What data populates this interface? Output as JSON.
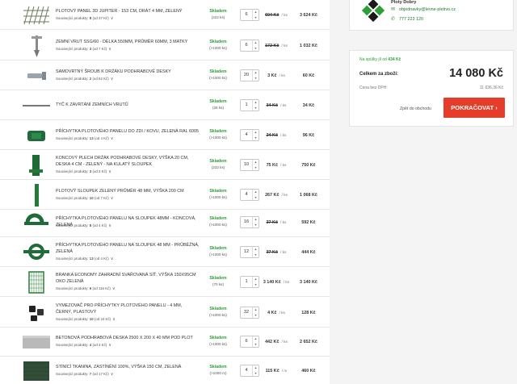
{
  "cart": {
    "items": [
      {
        "name": "Plotový panel 3D JUPITER - 153 cm, drát 4 mm, zelený",
        "related": {
          "prefix": "Související produkty:",
          "count": "8",
          "from": "(od 37 Kč)"
        },
        "stock": {
          "status": "Skladem",
          "qty": "(222 ks)"
        },
        "quantity": "6",
        "unit_price": "604 Kč",
        "unit": "/ ks",
        "strike": true,
        "total": "3 624 Kč"
      },
      {
        "name": "Zemní vrut SSG/60 - délka 550mm, průměr 60mm, 3 matky",
        "related": {
          "prefix": "Související produkty:",
          "count": "3",
          "from": "(od 7 Kč)"
        },
        "stock": {
          "status": "Skladem",
          "qty": "(>1000 ks)"
        },
        "quantity": "6",
        "unit_price": "172 Kč",
        "unit": "/ ks",
        "strike": true,
        "total": "1 032 Kč"
      },
      {
        "name": "Samovrtný šroub k držáku podhrabové desky",
        "related": {
          "prefix": "Související produkty:",
          "count": "2",
          "from": "(od 62 Kč)"
        },
        "stock": {
          "status": "Skladem",
          "qty": "(>1000 ks)"
        },
        "quantity": "20",
        "unit_price": "3 Kč",
        "unit": "/ ks",
        "strike": false,
        "total": "60 Kč"
      },
      {
        "name": "Tyč k zavrtání zemních vrutů",
        "related": null,
        "stock": {
          "status": "Skladem",
          "qty": "(28 ks)"
        },
        "quantity": "1",
        "unit_price": "34 Kč",
        "unit": "/ ks",
        "strike": true,
        "total": "34 Kč"
      },
      {
        "name": "Příchytka plotového panelu do zdi / kovu, zelená RAL 6005",
        "related": {
          "prefix": "Související produkty:",
          "count": "13",
          "from": "(od 4 Kč)"
        },
        "stock": {
          "status": "Skladem",
          "qty": "(>1000 ks)"
        },
        "quantity": "4",
        "unit_price": "24 Kč",
        "unit": "/ ks",
        "strike": true,
        "total": "96 Kč"
      },
      {
        "name": "Koncový plech držák podhrabové desky, výška 20 cm, deska 4 cm - zelený - na kulatý sloupek",
        "related": {
          "prefix": "Související produkty:",
          "count": "3",
          "from": "(od 3 Kč)"
        },
        "stock": {
          "status": "Skladem",
          "qty": "(232 ks)"
        },
        "quantity": "10",
        "unit_price": "75 Kč",
        "unit": "/ ks",
        "strike": false,
        "total": "750 Kč"
      },
      {
        "name": "Plotový sloupek zelený průměr 48 mm, výška 200 cm",
        "related": {
          "prefix": "Související produkty:",
          "count": "10",
          "from": "(od 7 Kč)"
        },
        "stock": {
          "status": "Skladem",
          "qty": "(>1000 ks)"
        },
        "quantity": "4",
        "unit_price": "267 Kč",
        "unit": "/ ks",
        "strike": false,
        "total": "1 068 Kč"
      },
      {
        "name": "Příchytka plotového panelu na sloupek 48mm - koncová, zelená",
        "related": {
          "prefix": "Související produkty:",
          "count": "8",
          "from": "(od 4 Kč)"
        },
        "stock": {
          "status": "Skladem",
          "qty": "(>1000 ks)"
        },
        "quantity": "16",
        "unit_price": "37 Kč",
        "unit": "/ ks",
        "strike": true,
        "total": "592 Kč"
      },
      {
        "name": "Příchytka plotového panelu na sloupek 48 mm - průběžná, zelená",
        "related": {
          "prefix": "Související produkty:",
          "count": "13",
          "from": "(od 4 Kč)"
        },
        "stock": {
          "status": "Skladem",
          "qty": "(>1000 ks)"
        },
        "quantity": "12",
        "unit_price": "37 Kč",
        "unit": "/ ks",
        "strike": true,
        "total": "444 Kč"
      },
      {
        "name": "Branka economy zahradní svařovaná síť, výška 150x95cm oko zelená",
        "related": {
          "prefix": "Související produkty:",
          "count": "6",
          "from": "(od 116 Kč)"
        },
        "stock": {
          "status": "Skladem",
          "qty": "(70 ks)"
        },
        "quantity": "1",
        "unit_price": "3 140 Kč",
        "unit": "/ ks",
        "strike": false,
        "total": "3 140 Kč"
      },
      {
        "name": "Vymezovač pro příchytky plotového panelu - 4 mm, černý, plastový",
        "related": {
          "prefix": "Související produkty:",
          "count": "10",
          "from": "(od 24 Kč)"
        },
        "stock": {
          "status": "Skladem",
          "qty": "(>1000 ks)"
        },
        "quantity": "32",
        "unit_price": "4 Kč",
        "unit": "/ ks",
        "strike": false,
        "total": "128 Kč"
      },
      {
        "name": "Betonová podhrabová deska 2500 x 200 x 40 mm pod plot",
        "related": {
          "prefix": "Související produkty:",
          "count": "4",
          "from": "(od 3 Kč)"
        },
        "stock": {
          "status": "Skladem",
          "qty": "(>1000 ks)"
        },
        "quantity": "6",
        "unit_price": "442 Kč",
        "unit": "/ ks",
        "strike": false,
        "total": "2 652 Kč"
      },
      {
        "name": "Stínící tkanina, zastínění 100%, výška 150 cm, zelená",
        "related": {
          "prefix": "Související produkty:",
          "count": "7",
          "from": "(od 17 Kč)"
        },
        "stock": {
          "status": "Skladem",
          "qty": "(>1000 m)"
        },
        "quantity": "4",
        "unit_price": "115 Kč",
        "unit": "/ m",
        "strike": false,
        "total": "460 Kč"
      }
    ]
  },
  "seller": {
    "name": "Ploty Dobry",
    "email": "objednavky@levne-pletivo.cz",
    "phone": "777 223 120",
    "icons": {
      "email": "envelope-icon",
      "phone": "phone-icon"
    }
  },
  "summary": {
    "shipping_prefix": "Na spülky jíl od",
    "shipping_amount": "434 Kč",
    "total_label": "Celkem za zboží:",
    "total_value": "14 080 Kč",
    "vat_label": "Cena bez DPH:",
    "vat_value": "11 636,36 Kč",
    "back_label": "Zpět do obchodu",
    "continue_label": "POKRAČOVAT",
    "accent_color": "#e63d2b"
  }
}
